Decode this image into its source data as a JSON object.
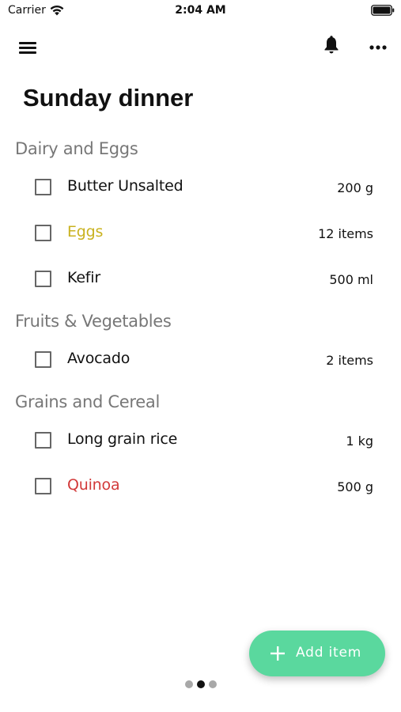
{
  "status_bar": {
    "carrier": "Carrier",
    "time": "2:04 AM"
  },
  "toolbar": {
    "icons": [
      "hamburger-menu-icon",
      "bell-icon",
      "more-horizontal-icon"
    ]
  },
  "title": "Sunday dinner",
  "sections": [
    {
      "header": "Dairy and Eggs",
      "items": [
        {
          "name": "Butter Unsalted",
          "qty": "200 g",
          "color": "#111111"
        },
        {
          "name": "Eggs",
          "qty": "12 items",
          "color": "#c9b21f"
        },
        {
          "name": "Kefir",
          "qty": "500 ml",
          "color": "#111111"
        }
      ]
    },
    {
      "header": "Fruits & Vegetables",
      "items": [
        {
          "name": "Avocado",
          "qty": "2 items",
          "color": "#111111"
        }
      ]
    },
    {
      "header": "Grains and Cereal",
      "items": [
        {
          "name": "Long grain rice",
          "qty": "1 kg",
          "color": "#111111"
        },
        {
          "name": "Quinoa",
          "qty": "500 g",
          "color": "#d23a3a"
        }
      ]
    }
  ],
  "fab": {
    "label": "Add item",
    "color": "#5ad89e"
  },
  "page_indicator": {
    "count": 3,
    "active": 1
  }
}
